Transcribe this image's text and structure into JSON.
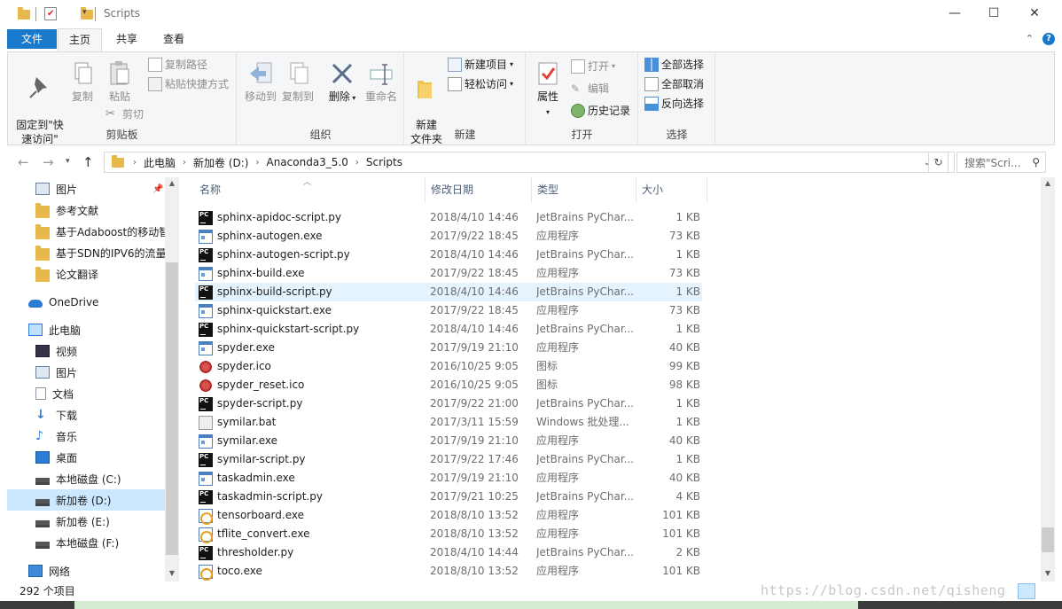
{
  "window": {
    "title": "Scripts",
    "controls": {
      "minimize": "—",
      "maximize": "☐",
      "close": "✕"
    }
  },
  "ribbon_tabs": [
    "文件",
    "主页",
    "共享",
    "查看"
  ],
  "ribbon": {
    "clipboard": {
      "label": "剪贴板",
      "pin": "固定到\"快\n速访问\"",
      "copy": "复制",
      "paste": "粘贴",
      "copy_path": "复制路径",
      "paste_shortcut": "粘贴快捷方式",
      "cut": "剪切"
    },
    "organize": {
      "label": "组织",
      "move_to": "移动到",
      "copy_to": "复制到",
      "delete": "删除",
      "rename": "重命名"
    },
    "new": {
      "label": "新建",
      "new_folder": "新建\n文件夹",
      "new_item": "新建项目",
      "easy_access": "轻松访问"
    },
    "open": {
      "label": "打开",
      "properties": "属性",
      "open": "打开",
      "edit": "编辑",
      "history": "历史记录"
    },
    "select": {
      "label": "选择",
      "select_all": "全部选择",
      "select_none": "全部取消",
      "invert": "反向选择"
    }
  },
  "address": {
    "crumbs": [
      "此电脑",
      "新加卷 (D:)",
      "Anaconda3_5.0",
      "Scripts"
    ],
    "search_placeholder": "搜索\"Scri..."
  },
  "nav": {
    "items": [
      {
        "label": "图片",
        "icon": "pictures-icon",
        "pinned": true
      },
      {
        "label": "参考文献",
        "icon": "folder-icon"
      },
      {
        "label": "基于Adaboost的移动智",
        "icon": "folder-icon"
      },
      {
        "label": "基于SDN的IPV6的流量",
        "icon": "folder-icon"
      },
      {
        "label": "论文翻译",
        "icon": "folder-icon"
      },
      {
        "label": "OneDrive",
        "icon": "onedrive-icon"
      },
      {
        "label": "此电脑",
        "icon": "this-pc-icon"
      },
      {
        "label": "视频",
        "icon": "videos-icon"
      },
      {
        "label": "图片",
        "icon": "pictures-icon"
      },
      {
        "label": "文档",
        "icon": "documents-icon"
      },
      {
        "label": "下载",
        "icon": "downloads-icon"
      },
      {
        "label": "音乐",
        "icon": "music-icon"
      },
      {
        "label": "桌面",
        "icon": "desktop-icon"
      },
      {
        "label": "本地磁盘 (C:)",
        "icon": "drive-c-icon"
      },
      {
        "label": "新加卷 (D:)",
        "icon": "drive-icon",
        "selected": true
      },
      {
        "label": "新加卷 (E:)",
        "icon": "drive-icon"
      },
      {
        "label": "本地磁盘 (F:)",
        "icon": "drive-icon"
      },
      {
        "label": "网络",
        "icon": "network-icon"
      }
    ]
  },
  "columns": {
    "name": "名称",
    "date": "修改日期",
    "type": "类型",
    "size": "大小"
  },
  "files": [
    {
      "name": "sphinx-apidoc-script.py",
      "date": "2018/4/10 14:46",
      "type": "JetBrains PyChar...",
      "size": "1 KB",
      "icon": "pycharm-icon"
    },
    {
      "name": "sphinx-autogen.exe",
      "date": "2017/9/22 18:45",
      "type": "应用程序",
      "size": "73 KB",
      "icon": "exe-icon"
    },
    {
      "name": "sphinx-autogen-script.py",
      "date": "2018/4/10 14:46",
      "type": "JetBrains PyChar...",
      "size": "1 KB",
      "icon": "pycharm-icon"
    },
    {
      "name": "sphinx-build.exe",
      "date": "2017/9/22 18:45",
      "type": "应用程序",
      "size": "73 KB",
      "icon": "exe-icon"
    },
    {
      "name": "sphinx-build-script.py",
      "date": "2018/4/10 14:46",
      "type": "JetBrains PyChar...",
      "size": "1 KB",
      "icon": "pycharm-icon",
      "hover": true
    },
    {
      "name": "sphinx-quickstart.exe",
      "date": "2017/9/22 18:45",
      "type": "应用程序",
      "size": "73 KB",
      "icon": "exe-icon"
    },
    {
      "name": "sphinx-quickstart-script.py",
      "date": "2018/4/10 14:46",
      "type": "JetBrains PyChar...",
      "size": "1 KB",
      "icon": "pycharm-icon"
    },
    {
      "name": "spyder.exe",
      "date": "2017/9/19 21:10",
      "type": "应用程序",
      "size": "40 KB",
      "icon": "exe-icon"
    },
    {
      "name": "spyder.ico",
      "date": "2016/10/25 9:05",
      "type": "图标",
      "size": "99 KB",
      "icon": "ico-icon"
    },
    {
      "name": "spyder_reset.ico",
      "date": "2016/10/25 9:05",
      "type": "图标",
      "size": "98 KB",
      "icon": "ico-icon"
    },
    {
      "name": "spyder-script.py",
      "date": "2017/9/22 21:00",
      "type": "JetBrains PyChar...",
      "size": "1 KB",
      "icon": "pycharm-icon"
    },
    {
      "name": "symilar.bat",
      "date": "2017/3/11 15:59",
      "type": "Windows 批处理...",
      "size": "1 KB",
      "icon": "bat-icon"
    },
    {
      "name": "symilar.exe",
      "date": "2017/9/19 21:10",
      "type": "应用程序",
      "size": "40 KB",
      "icon": "exe-icon"
    },
    {
      "name": "symilar-script.py",
      "date": "2017/9/22 17:46",
      "type": "JetBrains PyChar...",
      "size": "1 KB",
      "icon": "pycharm-icon"
    },
    {
      "name": "taskadmin.exe",
      "date": "2017/9/19 21:10",
      "type": "应用程序",
      "size": "40 KB",
      "icon": "exe-icon"
    },
    {
      "name": "taskadmin-script.py",
      "date": "2017/9/21 10:25",
      "type": "JetBrains PyChar...",
      "size": "4 KB",
      "icon": "pycharm-icon"
    },
    {
      "name": "tensorboard.exe",
      "date": "2018/8/10 13:52",
      "type": "应用程序",
      "size": "101 KB",
      "icon": "tf-exe-icon"
    },
    {
      "name": "tflite_convert.exe",
      "date": "2018/8/10 13:52",
      "type": "应用程序",
      "size": "101 KB",
      "icon": "tf-exe-icon"
    },
    {
      "name": "thresholder.py",
      "date": "2018/4/10 14:44",
      "type": "JetBrains PyChar...",
      "size": "2 KB",
      "icon": "pycharm-icon"
    },
    {
      "name": "toco.exe",
      "date": "2018/8/10 13:52",
      "type": "应用程序",
      "size": "101 KB",
      "icon": "tf-exe-icon"
    }
  ],
  "status": {
    "count": "292 个项目"
  },
  "watermark": "https://blog.csdn.net/qisheng"
}
